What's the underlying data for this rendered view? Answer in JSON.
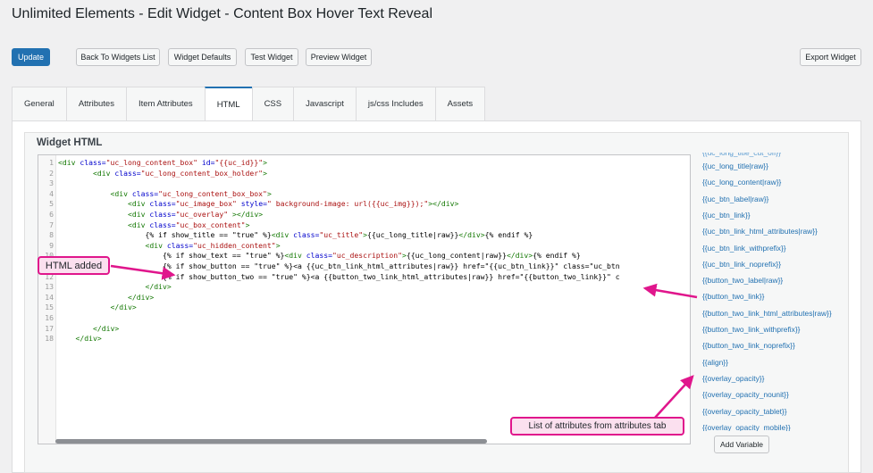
{
  "page": {
    "title": "Unlimited Elements - Edit Widget - Content Box Hover Text Reveal"
  },
  "toolbar": {
    "update": "Update",
    "back": "Back To Widgets List",
    "defaults": "Widget Defaults",
    "test": "Test Widget",
    "preview": "Preview Widget",
    "export": "Export Widget"
  },
  "tabs": [
    {
      "label": "General",
      "active": false
    },
    {
      "label": "Attributes",
      "active": false
    },
    {
      "label": "Item Attributes",
      "active": false
    },
    {
      "label": "HTML",
      "active": true
    },
    {
      "label": "CSS",
      "active": false
    },
    {
      "label": "Javascript",
      "active": false
    },
    {
      "label": "js/css Includes",
      "active": false
    },
    {
      "label": "Assets",
      "active": false
    }
  ],
  "section": {
    "title": "Widget HTML"
  },
  "editor": {
    "lines": [
      "<div class=\"uc_long_content_box\" id=\"{{uc_id}}\">",
      "        <div class=\"uc_long_content_box_holder\">",
      "",
      "            <div class=\"uc_long_content_box_box\">",
      "                <div class=\"uc_image_box\" style=\" background-image: url({{uc_img}});\"></div>",
      "                <div class=\"uc_overlay\" ></div>",
      "                <div class=\"uc_box_content\">",
      "                    {% if show_title == \"true\" %}<div class=\"uc_title\">{{uc_long_title|raw}}</div>{% endif %}",
      "                    <div class=\"uc_hidden_content\">",
      "                        {% if show_text == \"true\" %}<div class=\"uc_description\">{{uc_long_content|raw}}</div>{% endif %}",
      "                        {% if show_button == \"true\" %}<a {{uc_btn_link_html_attributes|raw}} href=\"{{uc_btn_link}}\" class=\"uc_btn",
      "                        {% if show_button_two == \"true\" %}<a {{button_two_link_html_attributes|raw}} href=\"{{button_two_link}}\" c",
      "                    </div>",
      "                </div>",
      "            </div>",
      "",
      "        </div>",
      "    </div>"
    ]
  },
  "variables": {
    "items": [
      "{{uc_long_title|raw}}",
      "{{uc_long_content|raw}}",
      "{{uc_btn_label|raw}}",
      "{{uc_btn_link}}",
      "{{uc_btn_link_html_attributes|raw}}",
      "{{uc_btn_link_withprefix}}",
      "{{uc_btn_link_noprefix}}",
      "{{button_two_label|raw}}",
      "{{button_two_link}}",
      "{{button_two_link_html_attributes|raw}}",
      "{{button_two_link_withprefix}}",
      "{{button_two_link_noprefix}}",
      "{{align}}",
      "{{overlay_opacity}}",
      "{{overlay_opacity_nounit}}",
      "{{overlay_opacity_tablet}}",
      "{{overlay_opacity_mobile}}"
    ],
    "add_button": "Add Variable"
  },
  "annotations": {
    "html_added": "HTML added",
    "attributes_list": "List of attributes from attributes tab"
  },
  "colors": {
    "accent": "#2271b1",
    "callout_border": "#e0168c",
    "callout_fill": "#fbe0ef"
  }
}
